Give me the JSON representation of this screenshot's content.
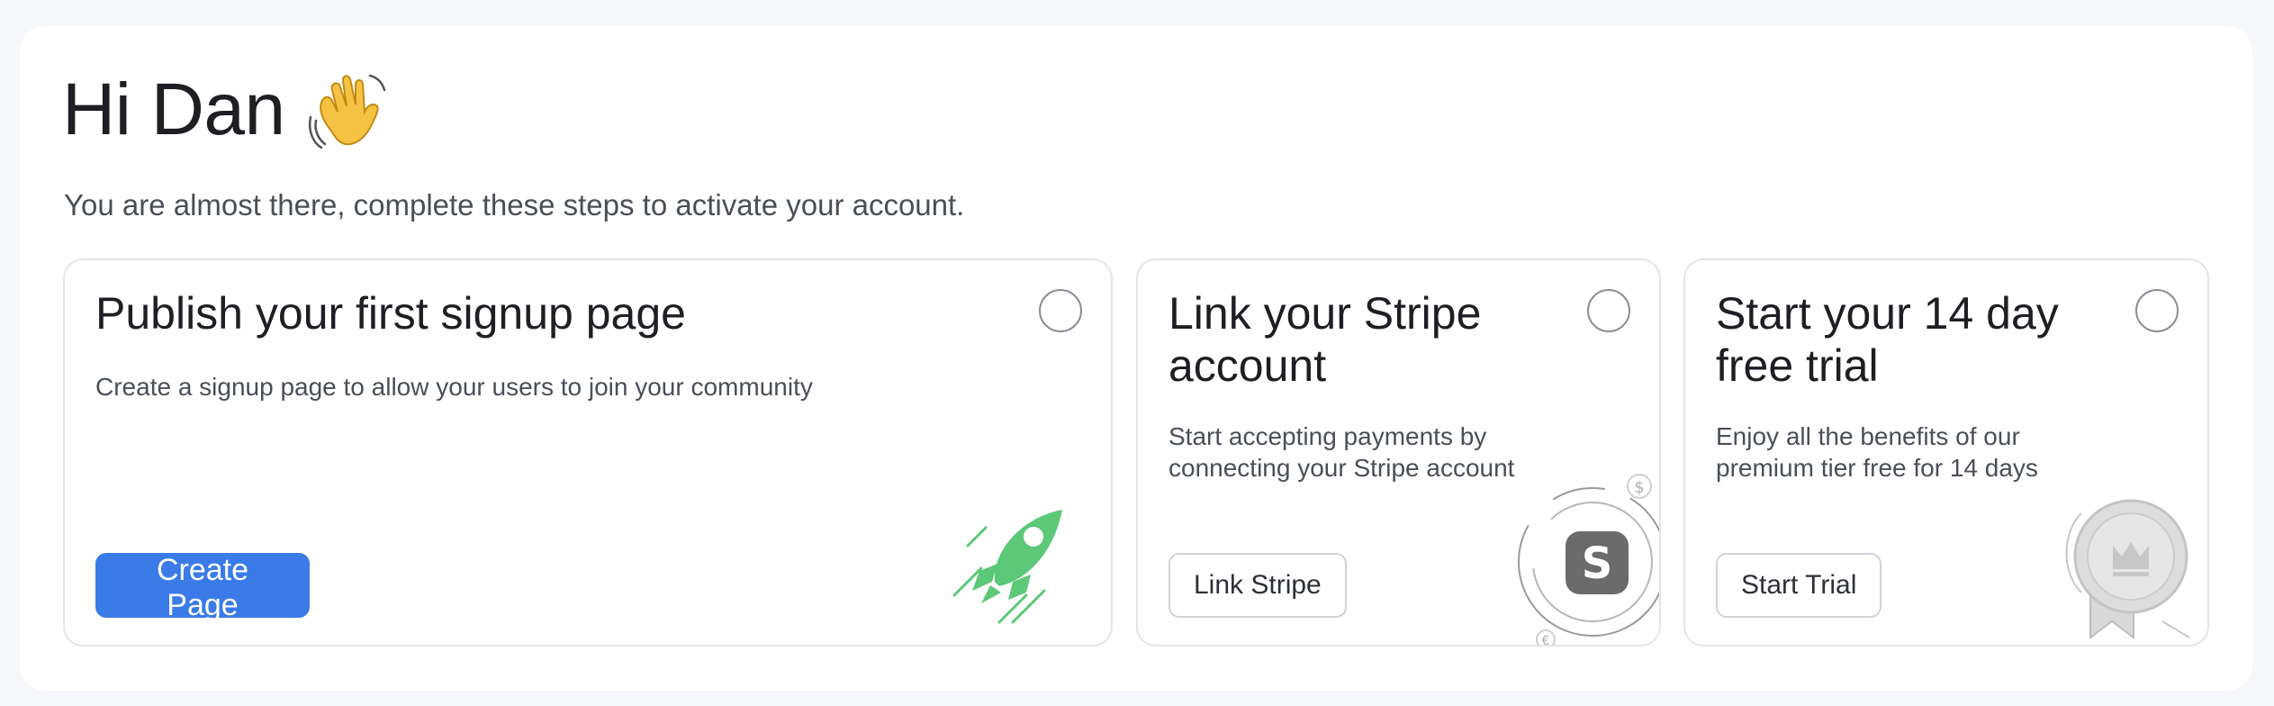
{
  "greeting": {
    "text": "Hi Dan",
    "emoji_icon": "waving-hand-icon"
  },
  "subtitle": "You are almost there, complete these steps to activate your account.",
  "cards": [
    {
      "title": "Publish your first signup page",
      "description": "Create a signup page to allow your users to join your community",
      "button_label": "Create Page",
      "button_style": "primary",
      "illustration_icon": "rocket-icon",
      "completed": false
    },
    {
      "title": "Link your Stripe account",
      "description": "Start accepting payments by connecting your Stripe account",
      "button_label": "Link Stripe",
      "button_style": "secondary",
      "illustration_icon": "stripe-logo-icon",
      "illustration_glyphs": [
        "S",
        "$",
        "€"
      ],
      "completed": false
    },
    {
      "title": "Start your 14 day free trial",
      "description": "Enjoy all the benefits of our premium tier free for 14 days",
      "button_label": "Start Trial",
      "button_style": "secondary",
      "illustration_icon": "award-crown-icon",
      "completed": false
    }
  ],
  "colors": {
    "page_background": "#f6f7fb",
    "panel_background": "#ffffff",
    "primary_button": "#3a7be8",
    "rocket_green": "#5cc878",
    "stripe_gray": "#6b6b6b",
    "card_border": "#e3e5ea"
  }
}
